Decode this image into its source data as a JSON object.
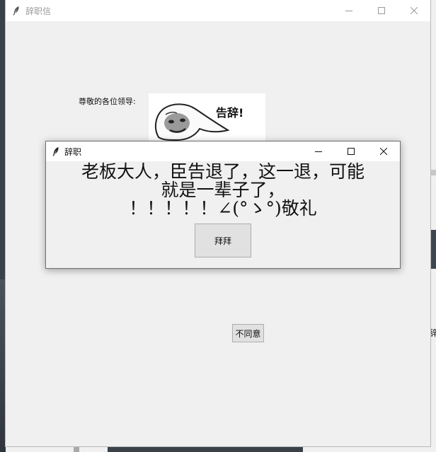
{
  "main_window": {
    "title": "辞职信",
    "greeting": "尊敬的各位领导:",
    "meme_caption": "告辞!",
    "disagree_label": "不同意"
  },
  "dialog": {
    "title": "辞职",
    "message_lines": [
      "老板大人，臣告退了，这一退，可能",
      "就是一辈子了，",
      "！！！！！∠(°ゝ°)敬礼"
    ],
    "bye_label": "拜拜"
  },
  "background": {
    "right_edge_text": "辞"
  }
}
